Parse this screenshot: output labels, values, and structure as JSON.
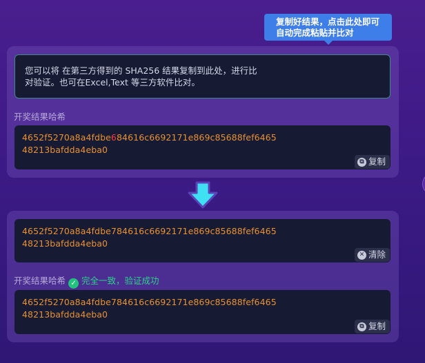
{
  "tooltip": {
    "line1": "复制好结果，点击此处即可",
    "line2": "自动完成粘贴并比对"
  },
  "top_panel": {
    "info_line1": "您可以将 在第三方得到的 SHA256 结果复制到此处，进行比",
    "info_line2": "对验证。也可在Excel,Text 等三方软件比对。",
    "result_label": "开奖结果哈希",
    "hash_line1_before": "4652f5270a8a4fdbe",
    "hash_line1_highlight": "6",
    "hash_line1_after": "84616c6692171e869c85688fef6465",
    "hash_line2": "48213bafdda4eba0",
    "copy_button": "复制"
  },
  "bottom_panel": {
    "input_line1": "4652f5270a8a4fdbe784616c6692171e869c85688fef6465",
    "input_line2": "48213bafdda4eba0",
    "clear_button": "清除",
    "result_label": "开奖结果哈希",
    "status_text": "完全一致，验证成功",
    "hash_line1": "4652f5270a8a4fdbe784616c6692171e869c85688fef6465",
    "hash_line2": "48213bafdda4eba0",
    "copy_button": "复制"
  },
  "colors": {
    "hash": "#e8922f",
    "mismatch": "#ff3b3b",
    "success": "#2ed08a",
    "tooltip": "#3e7ee8"
  },
  "icons": {
    "copy": "copy-icon",
    "clear": "close-circle-icon",
    "success": "check-circle-icon",
    "arrow": "arrow-down-icon"
  }
}
